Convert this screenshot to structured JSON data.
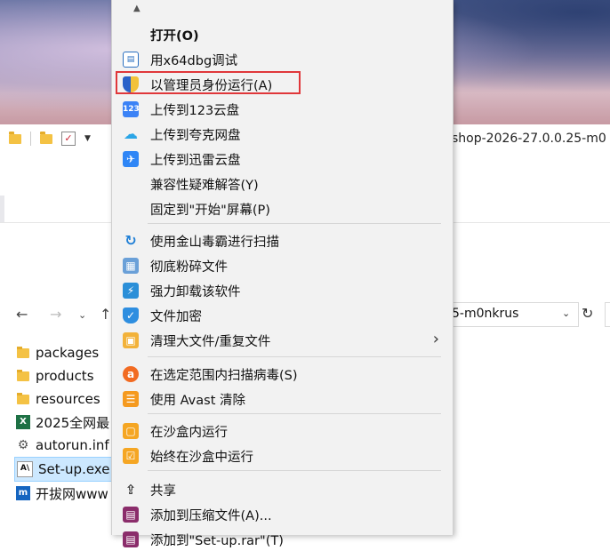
{
  "explorer": {
    "window_title": "shop-2026-27.0.0.25-m0",
    "address_path": "5-m0nkrus",
    "files": [
      {
        "name": "packages",
        "icon": "folder-icon"
      },
      {
        "name": "products",
        "icon": "folder-icon"
      },
      {
        "name": "resources",
        "icon": "folder-icon"
      },
      {
        "name": "2025全网最",
        "icon": "excel-icon"
      },
      {
        "name": "autorun.inf",
        "icon": "settings-file-icon"
      },
      {
        "name": "Set-up.exe",
        "icon": "adobe-installer-icon",
        "selected": true
      },
      {
        "name": "开拔网www",
        "icon": "web-shortcut-icon"
      }
    ]
  },
  "context_menu": {
    "items": [
      {
        "label": "打开(O)",
        "icon": "none"
      },
      {
        "label": "用x64dbg调试",
        "icon": "x64dbg-icon"
      },
      {
        "label": "以管理员身份运行(A)",
        "icon": "uac-shield-icon",
        "highlighted": true
      },
      {
        "label": "上传到123云盘",
        "icon": "123pan-icon"
      },
      {
        "label": "上传到夸克网盘",
        "icon": "quark-cloud-icon"
      },
      {
        "label": "上传到迅雷云盘",
        "icon": "xunlei-icon"
      },
      {
        "label": "兼容性疑难解答(Y)",
        "icon": "none"
      },
      {
        "label": "固定到\"开始\"屏幕(P)",
        "icon": "none"
      },
      {
        "label": "使用金山毒霸进行扫描",
        "icon": "kingsoft-antivirus-icon"
      },
      {
        "label": "彻底粉碎文件",
        "icon": "shredder-icon"
      },
      {
        "label": "强力卸载该软件",
        "icon": "uninstall-icon"
      },
      {
        "label": "文件加密",
        "icon": "shield-lock-icon"
      },
      {
        "label": "清理大文件/重复文件",
        "icon": "cleanup-icon"
      },
      {
        "label": "在选定范围内扫描病毒(S)",
        "icon": "avast-icon"
      },
      {
        "label": "使用 Avast 清除",
        "icon": "avast-clean-icon"
      },
      {
        "label": "在沙盒内运行",
        "icon": "sandbox-icon"
      },
      {
        "label": "始终在沙盒中运行",
        "icon": "sandbox-check-icon"
      },
      {
        "label": "共享",
        "icon": "share-icon"
      },
      {
        "label": "添加到压缩文件(A)...",
        "icon": "winrar-icon"
      },
      {
        "label": "添加到\"Set-up.rar\"(T)",
        "icon": "winrar-icon"
      }
    ]
  },
  "colors": {
    "highlight_border": "#e0373a",
    "menu_background": "#f2f2f2",
    "selected_file": "#cce8ff"
  }
}
